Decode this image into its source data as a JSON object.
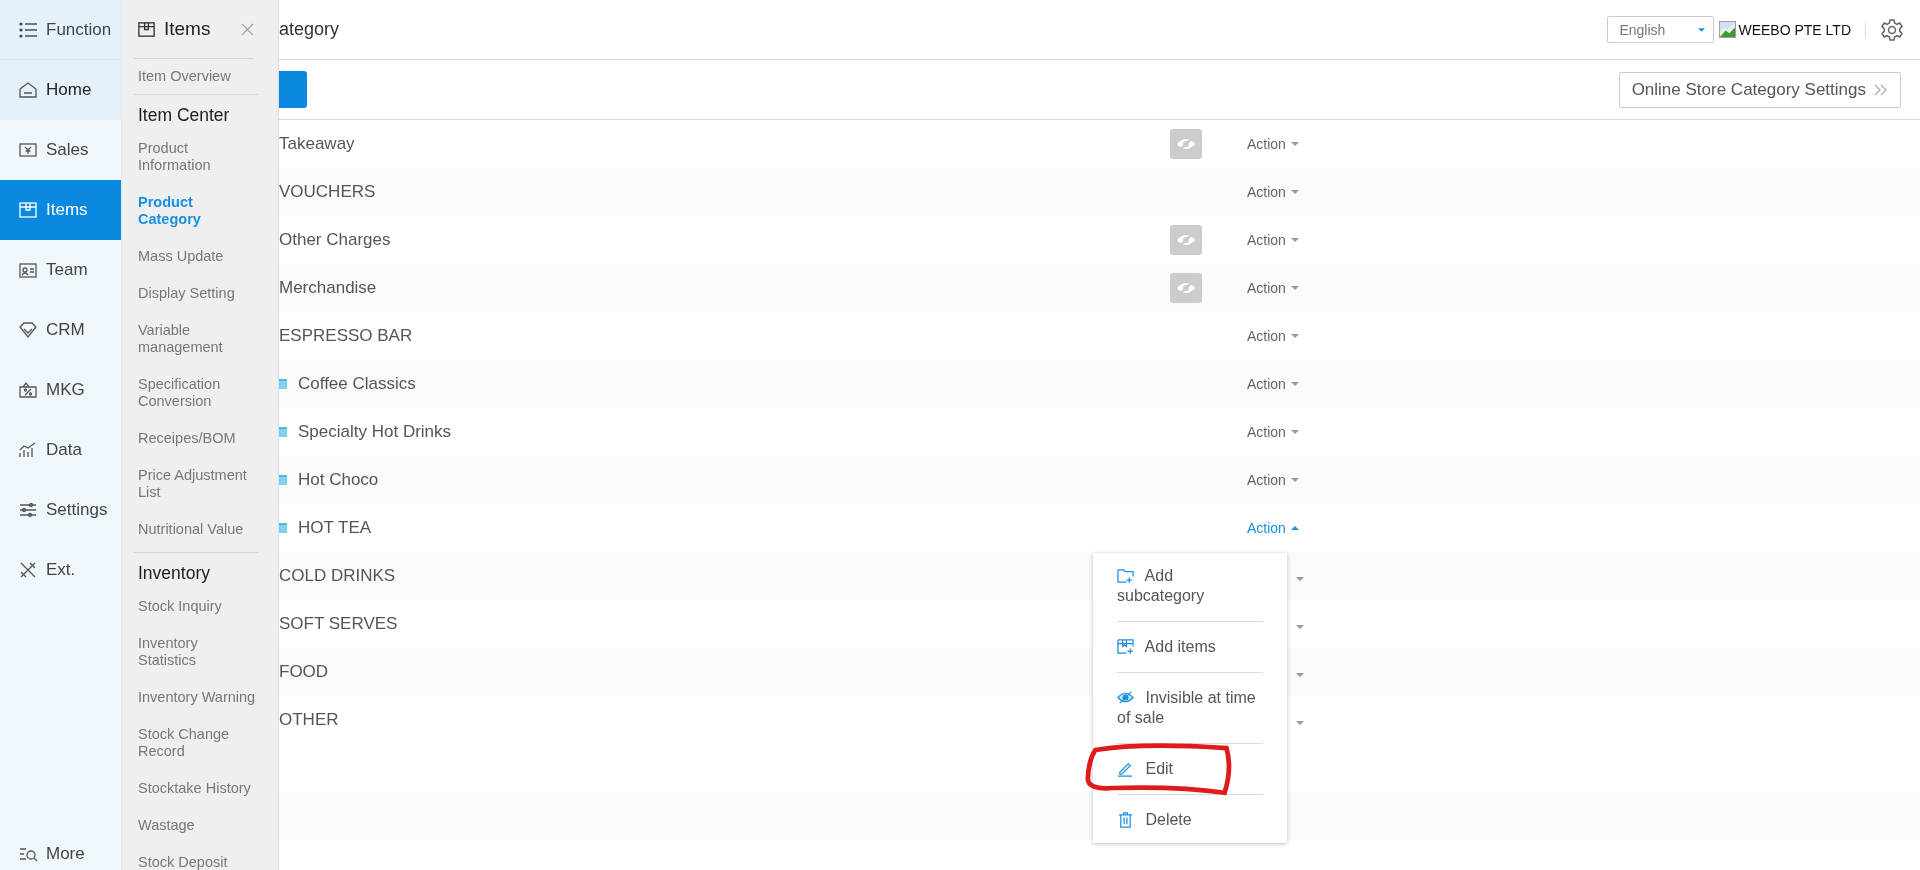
{
  "sidebar": {
    "header": "Function",
    "items": [
      {
        "label": "Home",
        "selected": false,
        "highlighted": true
      },
      {
        "label": "Sales",
        "selected": false,
        "highlighted": false
      },
      {
        "label": "Items",
        "selected": true,
        "highlighted": false
      },
      {
        "label": "Team",
        "selected": false,
        "highlighted": false
      },
      {
        "label": "CRM",
        "selected": false,
        "highlighted": false
      },
      {
        "label": "MKG",
        "selected": false,
        "highlighted": false
      },
      {
        "label": "Data",
        "selected": false,
        "highlighted": false
      },
      {
        "label": "Settings",
        "selected": false,
        "highlighted": false
      },
      {
        "label": "Ext.",
        "selected": false,
        "highlighted": false
      }
    ],
    "more": "More"
  },
  "panel": {
    "title": "Items",
    "overview": "Item Overview",
    "sections": [
      {
        "heading": "Item Center",
        "links": [
          {
            "label": "Product Information",
            "selected": false
          },
          {
            "label": "Product Category",
            "selected": true
          },
          {
            "label": "Mass Update",
            "selected": false
          },
          {
            "label": "Display Setting",
            "selected": false
          },
          {
            "label": "Variable management",
            "selected": false
          },
          {
            "label": "Specification Conversion",
            "selected": false
          },
          {
            "label": "Receipes/BOM",
            "selected": false
          },
          {
            "label": "Price Adjustment List",
            "selected": false
          },
          {
            "label": "Nutritional Value",
            "selected": false
          }
        ]
      },
      {
        "heading": "Inventory",
        "links": [
          {
            "label": "Stock Inquiry",
            "selected": false
          },
          {
            "label": "Inventory Statistics",
            "selected": false
          },
          {
            "label": "Inventory Warning",
            "selected": false
          },
          {
            "label": "Stock Change Record",
            "selected": false
          },
          {
            "label": "Stocktake History",
            "selected": false
          },
          {
            "label": "Wastage",
            "selected": false
          },
          {
            "label": "Stock Deposit",
            "selected": false
          }
        ]
      }
    ]
  },
  "header": {
    "title": "ategory",
    "language": "English",
    "company": "WEEBO PTE LTD"
  },
  "toolbar": {
    "settings_button": "Online Store Category Settings"
  },
  "table": {
    "rows": [
      {
        "name": "Takeaway",
        "kind": "category",
        "invisible": true,
        "action": "Action",
        "menu_open": false
      },
      {
        "name": "VOUCHERS",
        "kind": "category",
        "invisible": false,
        "action": "Action",
        "menu_open": false
      },
      {
        "name": "Other Charges",
        "kind": "category",
        "invisible": true,
        "action": "Action",
        "menu_open": false
      },
      {
        "name": "Merchandise",
        "kind": "category",
        "invisible": true,
        "action": "Action",
        "menu_open": false
      },
      {
        "name": "ESPRESSO BAR",
        "kind": "category",
        "invisible": false,
        "action": "Action",
        "menu_open": false
      },
      {
        "name": "Coffee Classics",
        "kind": "subcategory",
        "invisible": false,
        "action": "Action",
        "menu_open": false
      },
      {
        "name": "Specialty Hot Drinks",
        "kind": "subcategory",
        "invisible": false,
        "action": "Action",
        "menu_open": false
      },
      {
        "name": "Hot Choco",
        "kind": "subcategory",
        "invisible": false,
        "action": "Action",
        "menu_open": false
      },
      {
        "name": "HOT TEA",
        "kind": "subcategory",
        "invisible": false,
        "action": "Action",
        "menu_open": true
      },
      {
        "name": "COLD DRINKS",
        "kind": "category",
        "menu_open": false
      },
      {
        "name": "SOFT SERVES",
        "kind": "category",
        "menu_open": false
      },
      {
        "name": "FOOD",
        "kind": "category",
        "menu_open": false
      },
      {
        "name": "OTHER",
        "kind": "category",
        "menu_open": false
      }
    ]
  },
  "action_menu": {
    "items": [
      "Add subcategory",
      "Add items",
      "Invisible at time of sale",
      "Edit",
      "Delete"
    ]
  }
}
